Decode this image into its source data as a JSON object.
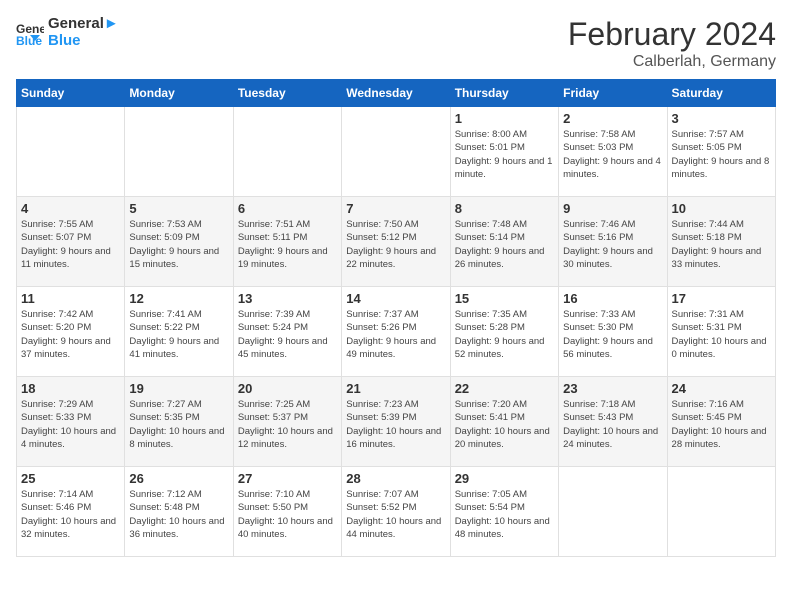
{
  "header": {
    "logo_line1": "General",
    "logo_line2": "Blue",
    "month_year": "February 2024",
    "location": "Calberlah, Germany"
  },
  "weekdays": [
    "Sunday",
    "Monday",
    "Tuesday",
    "Wednesday",
    "Thursday",
    "Friday",
    "Saturday"
  ],
  "weeks": [
    [
      {
        "day": "",
        "sunrise": "",
        "sunset": "",
        "daylight": ""
      },
      {
        "day": "",
        "sunrise": "",
        "sunset": "",
        "daylight": ""
      },
      {
        "day": "",
        "sunrise": "",
        "sunset": "",
        "daylight": ""
      },
      {
        "day": "",
        "sunrise": "",
        "sunset": "",
        "daylight": ""
      },
      {
        "day": "1",
        "sunrise": "Sunrise: 8:00 AM",
        "sunset": "Sunset: 5:01 PM",
        "daylight": "Daylight: 9 hours and 1 minute."
      },
      {
        "day": "2",
        "sunrise": "Sunrise: 7:58 AM",
        "sunset": "Sunset: 5:03 PM",
        "daylight": "Daylight: 9 hours and 4 minutes."
      },
      {
        "day": "3",
        "sunrise": "Sunrise: 7:57 AM",
        "sunset": "Sunset: 5:05 PM",
        "daylight": "Daylight: 9 hours and 8 minutes."
      }
    ],
    [
      {
        "day": "4",
        "sunrise": "Sunrise: 7:55 AM",
        "sunset": "Sunset: 5:07 PM",
        "daylight": "Daylight: 9 hours and 11 minutes."
      },
      {
        "day": "5",
        "sunrise": "Sunrise: 7:53 AM",
        "sunset": "Sunset: 5:09 PM",
        "daylight": "Daylight: 9 hours and 15 minutes."
      },
      {
        "day": "6",
        "sunrise": "Sunrise: 7:51 AM",
        "sunset": "Sunset: 5:11 PM",
        "daylight": "Daylight: 9 hours and 19 minutes."
      },
      {
        "day": "7",
        "sunrise": "Sunrise: 7:50 AM",
        "sunset": "Sunset: 5:12 PM",
        "daylight": "Daylight: 9 hours and 22 minutes."
      },
      {
        "day": "8",
        "sunrise": "Sunrise: 7:48 AM",
        "sunset": "Sunset: 5:14 PM",
        "daylight": "Daylight: 9 hours and 26 minutes."
      },
      {
        "day": "9",
        "sunrise": "Sunrise: 7:46 AM",
        "sunset": "Sunset: 5:16 PM",
        "daylight": "Daylight: 9 hours and 30 minutes."
      },
      {
        "day": "10",
        "sunrise": "Sunrise: 7:44 AM",
        "sunset": "Sunset: 5:18 PM",
        "daylight": "Daylight: 9 hours and 33 minutes."
      }
    ],
    [
      {
        "day": "11",
        "sunrise": "Sunrise: 7:42 AM",
        "sunset": "Sunset: 5:20 PM",
        "daylight": "Daylight: 9 hours and 37 minutes."
      },
      {
        "day": "12",
        "sunrise": "Sunrise: 7:41 AM",
        "sunset": "Sunset: 5:22 PM",
        "daylight": "Daylight: 9 hours and 41 minutes."
      },
      {
        "day": "13",
        "sunrise": "Sunrise: 7:39 AM",
        "sunset": "Sunset: 5:24 PM",
        "daylight": "Daylight: 9 hours and 45 minutes."
      },
      {
        "day": "14",
        "sunrise": "Sunrise: 7:37 AM",
        "sunset": "Sunset: 5:26 PM",
        "daylight": "Daylight: 9 hours and 49 minutes."
      },
      {
        "day": "15",
        "sunrise": "Sunrise: 7:35 AM",
        "sunset": "Sunset: 5:28 PM",
        "daylight": "Daylight: 9 hours and 52 minutes."
      },
      {
        "day": "16",
        "sunrise": "Sunrise: 7:33 AM",
        "sunset": "Sunset: 5:30 PM",
        "daylight": "Daylight: 9 hours and 56 minutes."
      },
      {
        "day": "17",
        "sunrise": "Sunrise: 7:31 AM",
        "sunset": "Sunset: 5:31 PM",
        "daylight": "Daylight: 10 hours and 0 minutes."
      }
    ],
    [
      {
        "day": "18",
        "sunrise": "Sunrise: 7:29 AM",
        "sunset": "Sunset: 5:33 PM",
        "daylight": "Daylight: 10 hours and 4 minutes."
      },
      {
        "day": "19",
        "sunrise": "Sunrise: 7:27 AM",
        "sunset": "Sunset: 5:35 PM",
        "daylight": "Daylight: 10 hours and 8 minutes."
      },
      {
        "day": "20",
        "sunrise": "Sunrise: 7:25 AM",
        "sunset": "Sunset: 5:37 PM",
        "daylight": "Daylight: 10 hours and 12 minutes."
      },
      {
        "day": "21",
        "sunrise": "Sunrise: 7:23 AM",
        "sunset": "Sunset: 5:39 PM",
        "daylight": "Daylight: 10 hours and 16 minutes."
      },
      {
        "day": "22",
        "sunrise": "Sunrise: 7:20 AM",
        "sunset": "Sunset: 5:41 PM",
        "daylight": "Daylight: 10 hours and 20 minutes."
      },
      {
        "day": "23",
        "sunrise": "Sunrise: 7:18 AM",
        "sunset": "Sunset: 5:43 PM",
        "daylight": "Daylight: 10 hours and 24 minutes."
      },
      {
        "day": "24",
        "sunrise": "Sunrise: 7:16 AM",
        "sunset": "Sunset: 5:45 PM",
        "daylight": "Daylight: 10 hours and 28 minutes."
      }
    ],
    [
      {
        "day": "25",
        "sunrise": "Sunrise: 7:14 AM",
        "sunset": "Sunset: 5:46 PM",
        "daylight": "Daylight: 10 hours and 32 minutes."
      },
      {
        "day": "26",
        "sunrise": "Sunrise: 7:12 AM",
        "sunset": "Sunset: 5:48 PM",
        "daylight": "Daylight: 10 hours and 36 minutes."
      },
      {
        "day": "27",
        "sunrise": "Sunrise: 7:10 AM",
        "sunset": "Sunset: 5:50 PM",
        "daylight": "Daylight: 10 hours and 40 minutes."
      },
      {
        "day": "28",
        "sunrise": "Sunrise: 7:07 AM",
        "sunset": "Sunset: 5:52 PM",
        "daylight": "Daylight: 10 hours and 44 minutes."
      },
      {
        "day": "29",
        "sunrise": "Sunrise: 7:05 AM",
        "sunset": "Sunset: 5:54 PM",
        "daylight": "Daylight: 10 hours and 48 minutes."
      },
      {
        "day": "",
        "sunrise": "",
        "sunset": "",
        "daylight": ""
      },
      {
        "day": "",
        "sunrise": "",
        "sunset": "",
        "daylight": ""
      }
    ]
  ]
}
